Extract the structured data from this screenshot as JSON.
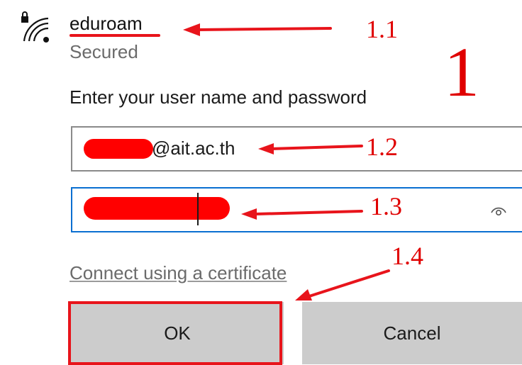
{
  "network": {
    "name": "eduroam",
    "status": "Secured",
    "icon": "wifi-secured-icon"
  },
  "prompt": "Enter your user name and password",
  "username": {
    "visible_value": "@ait.ac.th",
    "redacted": true
  },
  "password": {
    "redacted": true,
    "reveal_icon": "eye-icon"
  },
  "links": {
    "certificate": "Connect using a certificate"
  },
  "buttons": {
    "ok": "OK",
    "cancel": "Cancel"
  },
  "annotations": {
    "step": "1",
    "network_label": "1.1",
    "username_label": "1.2",
    "password_label": "1.3",
    "ok_label": "1.4"
  },
  "colors": {
    "annotation_red": "#e8141b",
    "focus_blue": "#0a6fd1",
    "button_gray": "#cccccc"
  }
}
